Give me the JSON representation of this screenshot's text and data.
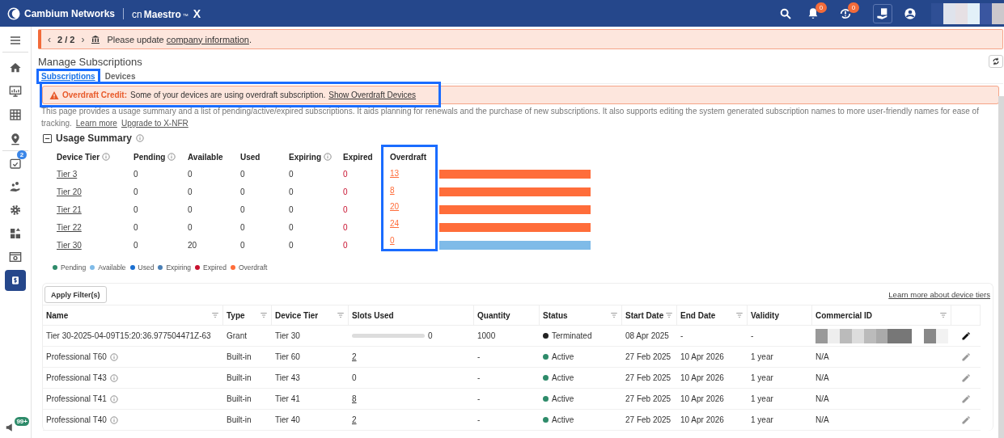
{
  "header": {
    "brand": "Cambium Networks",
    "product_prefix": "cn",
    "product": "Maestro",
    "trademark": "™",
    "product_suffix": "X",
    "alert_count": "0",
    "sync_count": "0",
    "user_redacted": true
  },
  "sidebar": {
    "items": [
      {
        "kind": "menu",
        "selected": false
      },
      {
        "kind": "home",
        "selected": false
      },
      {
        "kind": "monitor",
        "selected": false
      },
      {
        "kind": "calculator",
        "selected": false
      },
      {
        "kind": "pin",
        "selected": false
      },
      {
        "kind": "camera",
        "badge": "2",
        "selected": false
      },
      {
        "kind": "people",
        "selected": false
      },
      {
        "kind": "gear",
        "selected": false
      },
      {
        "kind": "grid",
        "selected": false
      },
      {
        "kind": "window",
        "selected": false
      },
      {
        "kind": "dollar",
        "selected": true
      }
    ],
    "bottom": {
      "kind": "flag",
      "badge": "99+"
    }
  },
  "notice": {
    "prev": "‹",
    "next": "›",
    "pager": "2 / 2",
    "text": "Please update",
    "link": "company information",
    "suffix": "."
  },
  "page": {
    "title": "Manage Subscriptions"
  },
  "tabs": [
    {
      "label": "Subscriptions",
      "selected": true,
      "highlighted": true
    },
    {
      "label": "Devices",
      "selected": false,
      "highlighted": false
    }
  ],
  "overdraft_banner": {
    "title": "Overdraft Credit:",
    "text": "Some of your devices are using overdraft subscription.",
    "link": "Show Overdraft Devices",
    "highlighted": true
  },
  "description": {
    "text": "This page provides a usage summary and a list of pending/active/expired subscriptions. It aids planning for renewals and the purchase of new subscriptions. It also supports editing the system generated subscription names to more user-friendly names for ease of tracking.",
    "links": [
      "Learn more",
      "Upgrade to X-NFR"
    ]
  },
  "usage_summary": {
    "title": "Usage Summary",
    "expanded": true,
    "overdraft_highlighted": true,
    "columns": [
      {
        "label": "Device Tier",
        "info": true
      },
      {
        "label": "Pending",
        "info": true
      },
      {
        "label": "Available",
        "info": false
      },
      {
        "label": "Used",
        "info": false
      },
      {
        "label": "Expiring",
        "info": true
      },
      {
        "label": "Expired",
        "info": false
      },
      {
        "label": "Overdraft",
        "info": false
      }
    ],
    "rows": [
      {
        "cells": [
          "Tier 3",
          "0",
          "0",
          "0",
          "0",
          "0",
          "13"
        ],
        "color": "#ff6d3a"
      },
      {
        "cells": [
          "Tier 20",
          "0",
          "0",
          "0",
          "0",
          "0",
          "8"
        ],
        "color": "#ff6d3a"
      },
      {
        "cells": [
          "Tier 21",
          "0",
          "0",
          "0",
          "0",
          "0",
          "20"
        ],
        "color": "#ff6d3a"
      },
      {
        "cells": [
          "Tier 22",
          "0",
          "0",
          "0",
          "0",
          "0",
          "24"
        ],
        "color": "#ff6d3a"
      },
      {
        "cells": [
          "Tier 30",
          "0",
          "20",
          "0",
          "0",
          "0",
          "0"
        ],
        "color": "#7fbbe8"
      }
    ],
    "legend": [
      {
        "label": "Pending",
        "color": "#2e8b6a"
      },
      {
        "label": "Available",
        "color": "#7fbbe8"
      },
      {
        "label": "Used",
        "color": "#1a6fd1"
      },
      {
        "label": "Expiring",
        "color": "#4a7fb5"
      },
      {
        "label": "Expired",
        "color": "#c8102e"
      },
      {
        "label": "Overdraft",
        "color": "#ff6d3a"
      }
    ]
  },
  "table": {
    "apply_filters": "Apply Filter(s)",
    "learn_more": "Learn more about device tiers",
    "columns": [
      {
        "label": "Name",
        "filterable": true
      },
      {
        "label": "Type",
        "filterable": true
      },
      {
        "label": "Device Tier",
        "filterable": true
      },
      {
        "label": "Slots Used",
        "filterable": false
      },
      {
        "label": "Quantity",
        "filterable": false
      },
      {
        "label": "Status",
        "filterable": true
      },
      {
        "label": "Start Date",
        "filterable": true
      },
      {
        "label": "End Date",
        "filterable": true
      },
      {
        "label": "Validity",
        "filterable": false
      },
      {
        "label": "Commercial ID",
        "filterable": true
      }
    ],
    "rows": [
      {
        "name": "Tier 30-2025-04-09T15:20:36.977504471Z-63",
        "info": false,
        "type": "Grant",
        "tier": "Tier 30",
        "slots": {
          "kind": "bar",
          "text": "0",
          "level": 0
        },
        "quantity": "1000",
        "status": "Terminated",
        "color": "#222222",
        "start": "08 Apr 2025",
        "end": "-",
        "validity": "-",
        "commercial_id_redacted": true,
        "edit_active": true
      },
      {
        "name": "Professional T60",
        "info": true,
        "type": "Built-in",
        "tier": "Tier 60",
        "slots": {
          "kind": "link",
          "text": "2"
        },
        "quantity": "-",
        "status": "Active",
        "color": "#2e8b6a",
        "start": "27 Feb 2025",
        "end": "10 Apr 2026",
        "validity": "1 year",
        "commercial_id": "N/A",
        "commercial_id_redacted": false,
        "edit_active": false
      },
      {
        "name": "Professional T43",
        "info": true,
        "type": "Built-in",
        "tier": "Tier 43",
        "slots": {
          "kind": "plain",
          "text": "0"
        },
        "quantity": "-",
        "status": "Active",
        "color": "#2e8b6a",
        "start": "27 Feb 2025",
        "end": "10 Apr 2026",
        "validity": "1 year",
        "commercial_id": "N/A",
        "commercial_id_redacted": false,
        "edit_active": false
      },
      {
        "name": "Professional T41",
        "info": true,
        "type": "Built-in",
        "tier": "Tier 41",
        "slots": {
          "kind": "link",
          "text": "8"
        },
        "quantity": "-",
        "status": "Active",
        "color": "#2e8b6a",
        "start": "27 Feb 2025",
        "end": "10 Apr 2026",
        "validity": "1 year",
        "commercial_id": "N/A",
        "commercial_id_redacted": false,
        "edit_active": false
      },
      {
        "name": "Professional T40",
        "info": true,
        "type": "Built-in",
        "tier": "Tier 40",
        "slots": {
          "kind": "link",
          "text": "2"
        },
        "quantity": "-",
        "status": "Active",
        "color": "#2e8b6a",
        "start": "27 Feb 2025",
        "end": "10 Apr 2026",
        "validity": "1 year",
        "commercial_id": "N/A",
        "commercial_id_redacted": false,
        "edit_active": false
      }
    ]
  }
}
